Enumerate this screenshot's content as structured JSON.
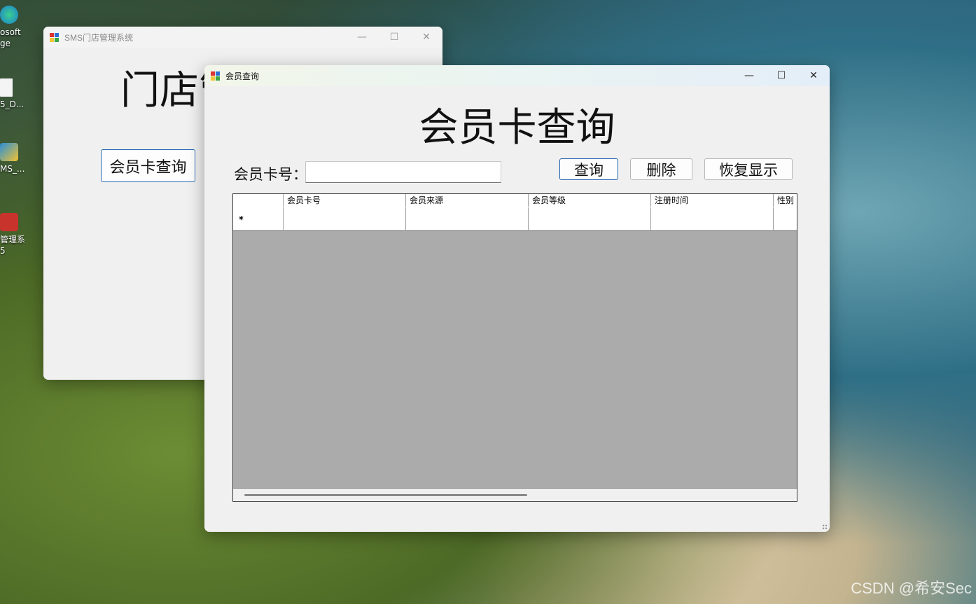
{
  "desktop": {
    "icons": [
      {
        "label": "osoft\nge"
      },
      {
        "label": "5_D..."
      },
      {
        "label": "MS_..."
      },
      {
        "label": "管理系\n5"
      }
    ],
    "watermark": "CSDN @希安Sec"
  },
  "main_window": {
    "title": "SMS门店管理系统",
    "heading": "门店管理系统",
    "member_query_button": "会员卡查询"
  },
  "query_window": {
    "title": "会员查询",
    "heading": "会员卡查询",
    "card_label": "会员卡号：",
    "card_input_value": "",
    "buttons": {
      "query": "查询",
      "delete": "删除",
      "restore": "恢复显示"
    },
    "grid": {
      "columns": [
        "会员卡号",
        "会员来源",
        "会员等级",
        "注册时间",
        "性别"
      ],
      "new_row_marker": "*"
    }
  },
  "window_controls": {
    "minimize": "—",
    "maximize": "☐",
    "close": "✕"
  }
}
